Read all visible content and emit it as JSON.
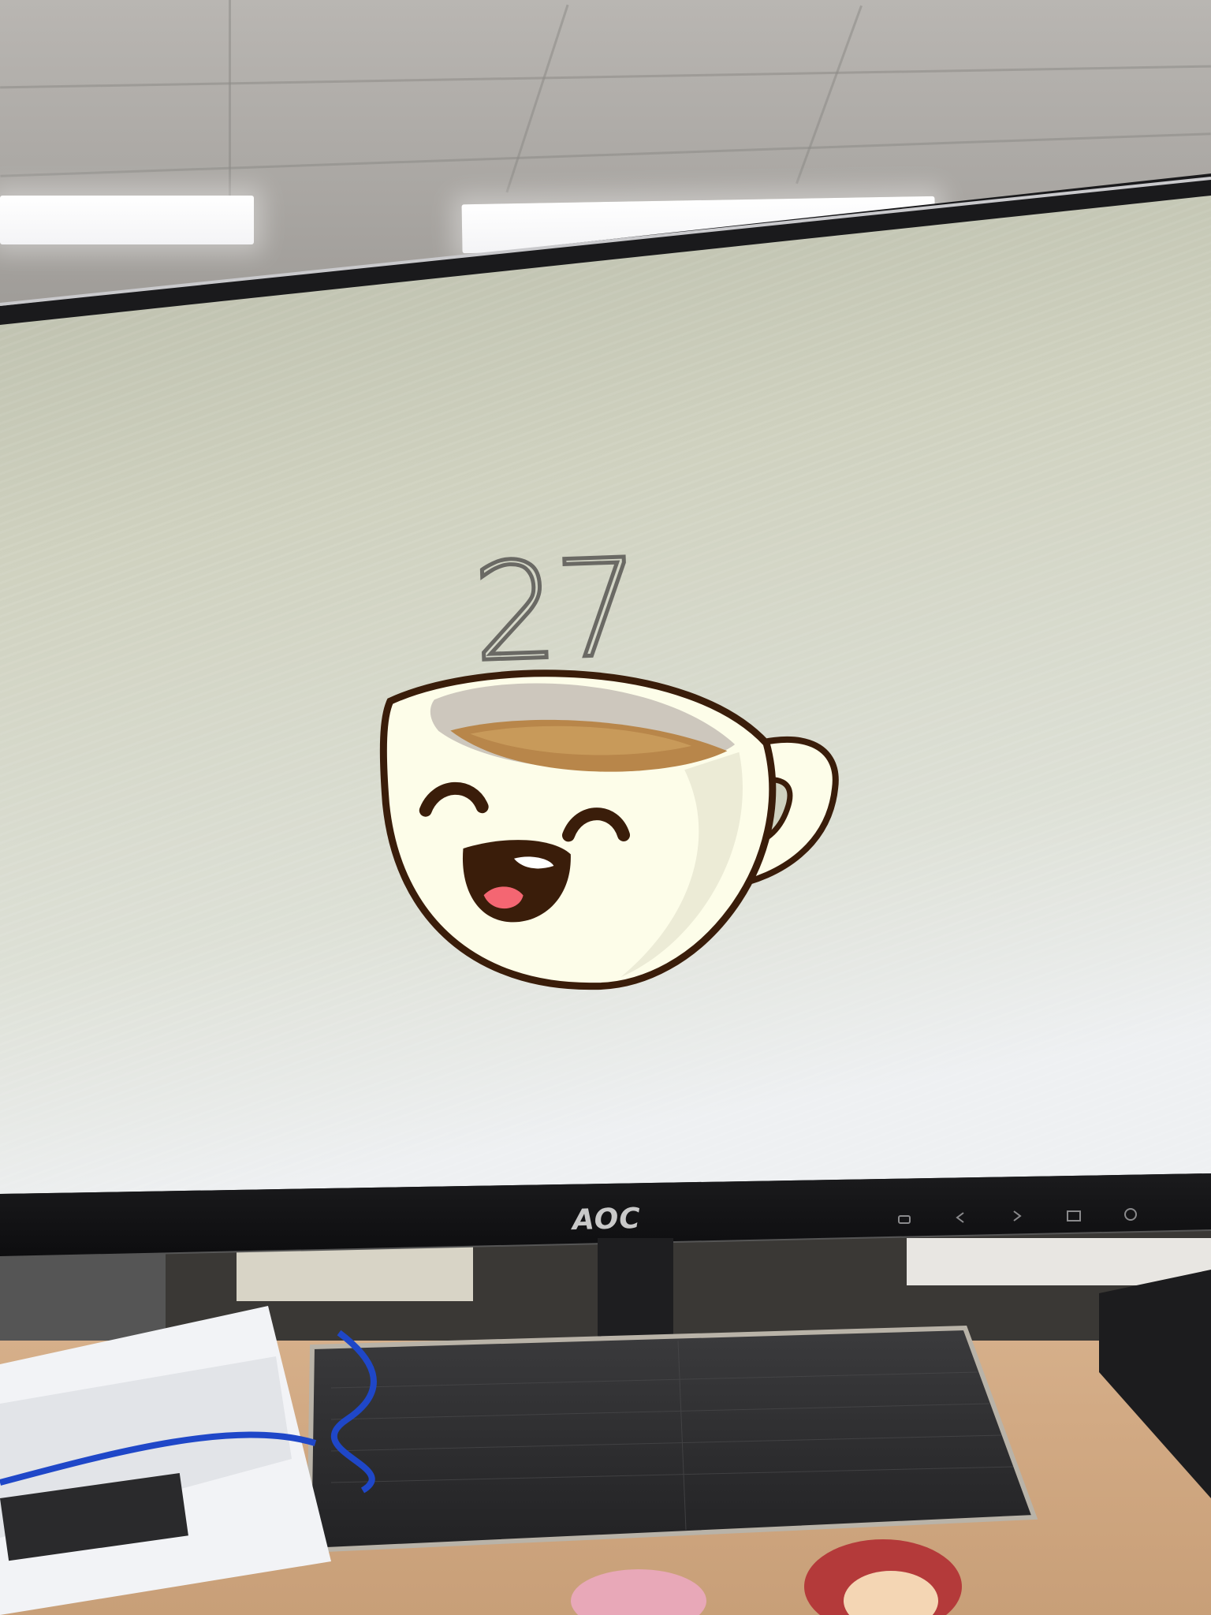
{
  "scene": {
    "clock_text": "27",
    "monitor_brand": "AOC",
    "icons": [
      "coffee-cup-mascot-icon",
      "monitor-button-icons"
    ]
  }
}
